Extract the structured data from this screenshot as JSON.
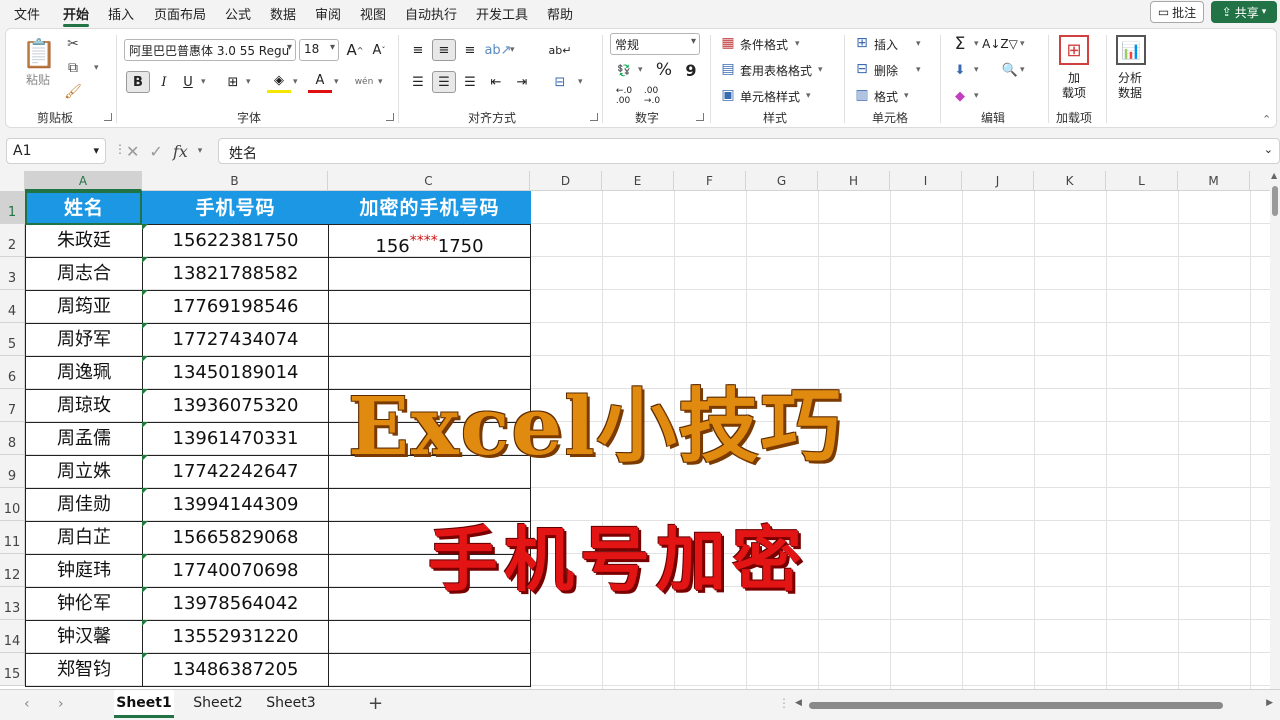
{
  "menu": {
    "items": [
      "文件",
      "开始",
      "插入",
      "页面布局",
      "公式",
      "数据",
      "审阅",
      "视图",
      "自动执行",
      "开发工具",
      "帮助"
    ],
    "active_index": 1,
    "comment_label": "批注",
    "share_label": "共享"
  },
  "ribbon": {
    "clipboard": {
      "paste_label": "粘贴",
      "group_label": "剪贴板"
    },
    "font": {
      "font_name": "阿里巴巴普惠体 3.0 55 Regu",
      "font_size": "18",
      "bold": "B",
      "italic": "I",
      "underline": "U",
      "group_label": "字体"
    },
    "alignment": {
      "group_label": "对齐方式"
    },
    "number": {
      "format": "常规",
      "percent": "%",
      "comma": "9",
      "group_label": "数字"
    },
    "styles": {
      "conditional": "条件格式",
      "table_format": "套用表格格式",
      "cell_style": "单元格样式",
      "group_label": "样式"
    },
    "cells": {
      "insert": "插入",
      "delete": "删除",
      "format": "格式",
      "group_label": "单元格"
    },
    "editing": {
      "sum": "Σ",
      "group_label": "编辑"
    },
    "addins": {
      "label_line1": "加",
      "label_line2": "载项",
      "group_label": "加载项"
    },
    "analysis": {
      "label_line1": "分析",
      "label_line2": "数据"
    }
  },
  "formula_bar": {
    "name_box": "A1",
    "fx": "fx",
    "content": "姓名"
  },
  "grid": {
    "columns": [
      "A",
      "B",
      "C",
      "D",
      "E",
      "F",
      "G",
      "H",
      "I",
      "J",
      "K",
      "L",
      "M"
    ],
    "rows": [
      "1",
      "2",
      "3",
      "4",
      "5",
      "6",
      "7",
      "8",
      "9",
      "10",
      "11",
      "12",
      "13",
      "14",
      "15"
    ],
    "header": [
      "姓名",
      "手机号码",
      "加密的手机号码"
    ],
    "data": [
      {
        "name": "朱政廷",
        "phone": "15622381750",
        "enc_prefix": "156",
        "enc_stars": "****",
        "enc_suffix": "1750"
      },
      {
        "name": "周志合",
        "phone": "13821788582"
      },
      {
        "name": "周筠亚",
        "phone": "17769198546"
      },
      {
        "name": "周妤军",
        "phone": "17727434074"
      },
      {
        "name": "周逸珮",
        "phone": "13450189014"
      },
      {
        "name": "周琼玫",
        "phone": "13936075320"
      },
      {
        "name": "周孟儒",
        "phone": "13961470331"
      },
      {
        "name": "周立姝",
        "phone": "17742242647"
      },
      {
        "name": "周佳勋",
        "phone": "13994144309"
      },
      {
        "name": "周白芷",
        "phone": "15665829068"
      },
      {
        "name": "钟庭玮",
        "phone": "17740070698"
      },
      {
        "name": "钟伦军",
        "phone": "13978564042"
      },
      {
        "name": "钟汉馨",
        "phone": "13552931220"
      },
      {
        "name": "郑智钧",
        "phone": "13486387205"
      }
    ]
  },
  "overlay": {
    "title": "Excel小技巧",
    "subtitle": "手机号加密"
  },
  "sheets": {
    "tabs": [
      "Sheet1",
      "Sheet2",
      "Sheet3"
    ],
    "active_index": 0,
    "add": "+"
  },
  "colors": {
    "accent": "#217346",
    "header_fill": "#1c97e3",
    "mask_red": "#d01010",
    "title_orange": "#e08a10",
    "subtitle_red": "#e21414"
  }
}
